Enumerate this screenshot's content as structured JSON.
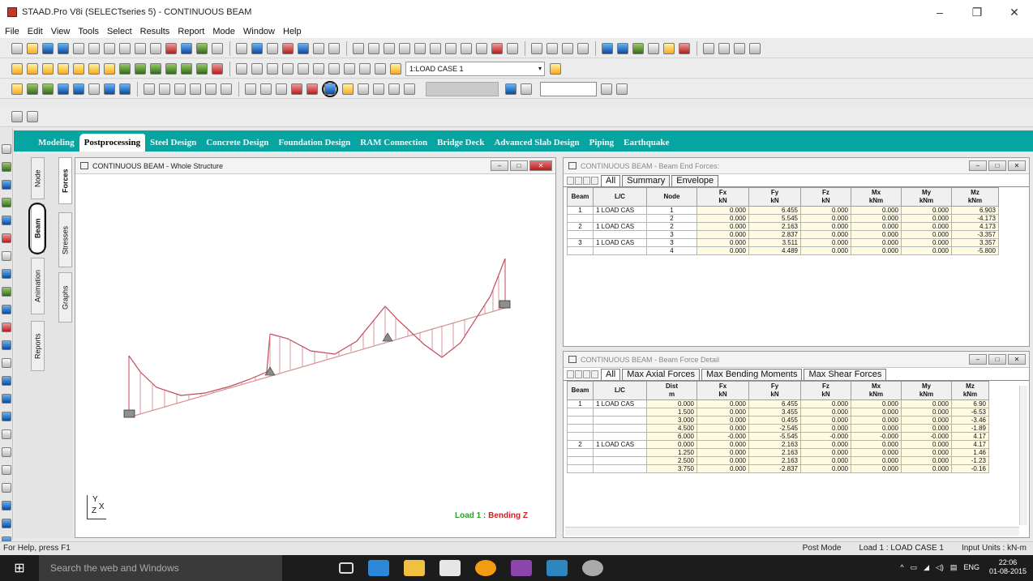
{
  "window": {
    "title": "STAAD.Pro V8i (SELECTseries 5) - CONTINUOUS BEAM",
    "minimize": "–",
    "restore": "❐",
    "close": "✕"
  },
  "menu": [
    "File",
    "Edit",
    "View",
    "Tools",
    "Select",
    "Results",
    "Report",
    "Mode",
    "Window",
    "Help"
  ],
  "toolbar": {
    "load_case": "1:LOAD CASE 1",
    "dropdown_arrow": "▾"
  },
  "tabs": [
    "Modeling",
    "Postprocessing",
    "Steel Design",
    "Concrete Design",
    "Foundation Design",
    "RAM Connection",
    "Bridge Deck",
    "Advanced Slab Design",
    "Piping",
    "Earthquake"
  ],
  "active_tab": "Postprocessing",
  "side_tabs": {
    "col1": [
      "Node",
      "Beam",
      "Animation",
      "Reports"
    ],
    "col2": [
      "Forces",
      "Stresses",
      "Graphs"
    ]
  },
  "drawing_window": {
    "title": "CONTINUOUS BEAM - Whole Structure",
    "load_label_prefix": "Load 1 :",
    "load_label_suffix": "Bending Z",
    "axis_y": "Y",
    "axis_x": "X",
    "axis_z": "Z"
  },
  "end_forces": {
    "title": "CONTINUOUS BEAM - Beam End Forces:",
    "subtabs": [
      "All",
      "Summary",
      "Envelope"
    ],
    "headers": [
      [
        "Beam",
        ""
      ],
      [
        "L/C",
        ""
      ],
      [
        "Node",
        ""
      ],
      [
        "Fx",
        "kN"
      ],
      [
        "Fy",
        "kN"
      ],
      [
        "Fz",
        "kN"
      ],
      [
        "Mx",
        "kNm"
      ],
      [
        "My",
        "kNm"
      ],
      [
        "Mz",
        "kNm"
      ]
    ],
    "rows": [
      [
        "1",
        "1 LOAD CAS",
        "1",
        "0.000",
        "6.455",
        "0.000",
        "0.000",
        "0.000",
        "6.903"
      ],
      [
        "",
        "",
        "2",
        "0.000",
        "5.545",
        "0.000",
        "0.000",
        "0.000",
        "-4.173"
      ],
      [
        "2",
        "1 LOAD CAS",
        "2",
        "0.000",
        "2.163",
        "0.000",
        "0.000",
        "0.000",
        "4.173"
      ],
      [
        "",
        "",
        "3",
        "0.000",
        "2.837",
        "0.000",
        "0.000",
        "0.000",
        "-3.357"
      ],
      [
        "3",
        "1 LOAD CAS",
        "3",
        "0.000",
        "3.511",
        "0.000",
        "0.000",
        "0.000",
        "3.357"
      ],
      [
        "",
        "",
        "4",
        "0.000",
        "4.489",
        "0.000",
        "0.000",
        "0.000",
        "-5.800"
      ]
    ]
  },
  "force_detail": {
    "title": "CONTINUOUS BEAM - Beam Force Detail",
    "subtabs": [
      "All",
      "Max Axial Forces",
      "Max Bending Moments",
      "Max Shear Forces"
    ],
    "headers": [
      [
        "Beam",
        ""
      ],
      [
        "L/C",
        ""
      ],
      [
        "Dist",
        "m"
      ],
      [
        "Fx",
        "kN"
      ],
      [
        "Fy",
        "kN"
      ],
      [
        "Fz",
        "kN"
      ],
      [
        "Mx",
        "kNm"
      ],
      [
        "My",
        "kNm"
      ],
      [
        "Mz",
        "kNm"
      ]
    ],
    "rows": [
      [
        "1",
        "1 LOAD CAS",
        "0.000",
        "0.000",
        "6.455",
        "0.000",
        "0.000",
        "0.000",
        "6.90"
      ],
      [
        "",
        "",
        "1.500",
        "0.000",
        "3.455",
        "0.000",
        "0.000",
        "0.000",
        "-6.53"
      ],
      [
        "",
        "",
        "3.000",
        "0.000",
        "0.455",
        "0.000",
        "0.000",
        "0.000",
        "-3.46"
      ],
      [
        "",
        "",
        "4.500",
        "0.000",
        "-2.545",
        "0.000",
        "0.000",
        "0.000",
        "-1.89"
      ],
      [
        "",
        "",
        "6.000",
        "-0.000",
        "-5.545",
        "-0.000",
        "-0.000",
        "-0.000",
        "4.17"
      ],
      [
        "2",
        "1 LOAD CAS",
        "0.000",
        "0.000",
        "2.163",
        "0.000",
        "0.000",
        "0.000",
        "4.17"
      ],
      [
        "",
        "",
        "1.250",
        "0.000",
        "2.163",
        "0.000",
        "0.000",
        "0.000",
        "1.46"
      ],
      [
        "",
        "",
        "2.500",
        "0.000",
        "2.163",
        "0.000",
        "0.000",
        "0.000",
        "-1.23"
      ],
      [
        "",
        "",
        "3.750",
        "0.000",
        "-2.837",
        "0.000",
        "0.000",
        "0.000",
        "-0.16"
      ]
    ]
  },
  "status": {
    "left": "For Help, press F1",
    "mode": "Post Mode",
    "load": "Load 1 : LOAD CASE 1",
    "units": "Input Units : kN-m"
  },
  "taskbar": {
    "search": "Search the web and Windows",
    "lang": "ENG",
    "time": "22:06",
    "date": "01-08-2015"
  }
}
